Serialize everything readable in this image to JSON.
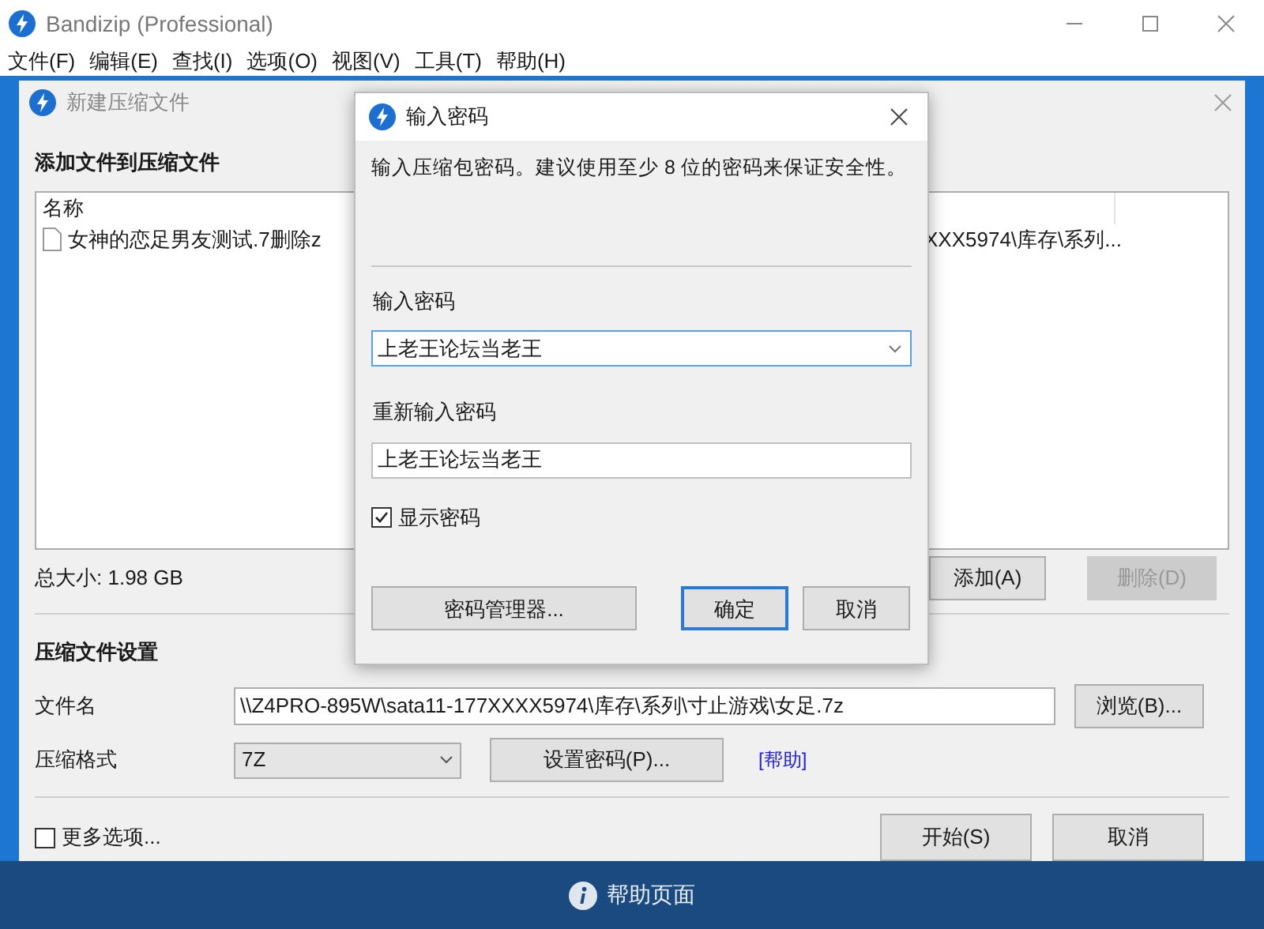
{
  "window": {
    "title": "Bandizip (Professional)"
  },
  "menu": [
    "文件(F)",
    "编辑(E)",
    "查找(I)",
    "选项(O)",
    "视图(V)",
    "工具(T)",
    "帮助(H)"
  ],
  "compress_dialog": {
    "title": "新建压缩文件",
    "heading": "添加文件到压缩文件",
    "file_list": {
      "columns": [
        "名称"
      ],
      "rows": [
        {
          "name": "女神的恋足男友测试.7删除z",
          "column_2": "XXX5974\\库存\\系列..."
        }
      ]
    },
    "total_size": "总大小: 1.98 GB",
    "list_buttons": [
      {
        "label": "添加(A)",
        "disabled": false
      },
      {
        "label": "删除(D)",
        "disabled": true
      }
    ],
    "settings_heading": "压缩文件设置",
    "filename": {
      "label": "文件名",
      "value": "\\\\Z4PRO-895W\\sata11-177XXXX5974\\库存\\系列\\寸止游戏\\女足.7z",
      "button": "浏览(B)..."
    },
    "format": {
      "label": "压缩格式",
      "value": "7Z",
      "password_button": "设置密码(P)...",
      "help_link": "[帮助]"
    },
    "more_options": {
      "label": "更多选项...",
      "checked": false
    },
    "buttons": [
      "开始(S)",
      "取消"
    ]
  },
  "password_dialog": {
    "title": "输入密码",
    "message": "输入压缩包密码。建议使用至少 8 位的密码来保证安全性。",
    "password": {
      "label": "输入密码",
      "value": "上老王论坛当老王"
    },
    "confirm": {
      "label": "重新输入密码",
      "value": "上老王论坛当老王"
    },
    "show_password": {
      "label": "显示密码",
      "checked": true
    },
    "manager_button": "密码管理器...",
    "buttons": [
      {
        "label": "确定",
        "default": true
      },
      {
        "label": "取消",
        "default": false
      }
    ]
  },
  "help_bar": {
    "label": "帮助页面"
  }
}
